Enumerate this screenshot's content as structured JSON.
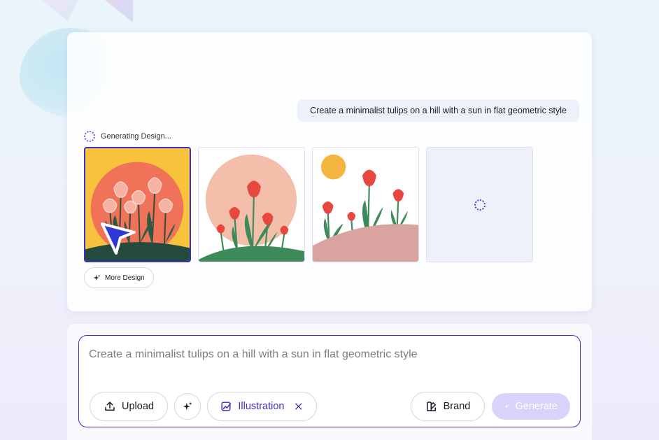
{
  "conversation": {
    "user_prompt": "Create a minimalist tulips on a hill with a sun in flat geometric style",
    "status_text": "Generating Design...",
    "more_design_label": "More Design"
  },
  "results": {
    "selected_index": 0,
    "tiles": [
      {
        "name": "design-option-1",
        "state": "ready"
      },
      {
        "name": "design-option-2",
        "state": "ready"
      },
      {
        "name": "design-option-3",
        "state": "ready"
      },
      {
        "name": "design-option-4",
        "state": "loading"
      }
    ]
  },
  "composer": {
    "placeholder": "Create a minimalist tulips on a hill with a sun in flat geometric style",
    "upload_label": "Upload",
    "style_chip_label": "Illustration",
    "brand_label": "Brand",
    "generate_label": "Generate"
  },
  "colors": {
    "accent": "#3d30c6",
    "generate_disabled": "#d8d3fb",
    "tulip_red": "#e8473d",
    "leaf_green": "#3f8a5a",
    "sun_yellow": "#f5b640"
  },
  "icons": {
    "upload": "upload-icon",
    "magic": "sparkle-icon",
    "illustration": "illustration-icon",
    "close": "close-icon",
    "brand": "brand-icon",
    "generate": "sparkle-icon"
  }
}
